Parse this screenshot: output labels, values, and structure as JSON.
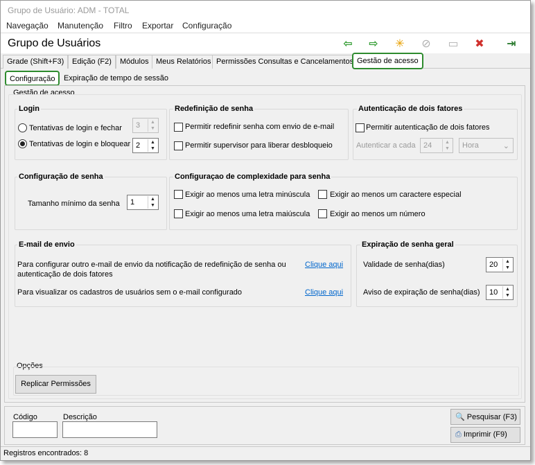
{
  "window": {
    "title": "Grupo de Usuário: ADM - TOTAL"
  },
  "menu": [
    "Navegação",
    "Manutenção",
    "Filtro",
    "Exportar",
    "Configuração"
  ],
  "header": {
    "title": "Grupo de Usuários"
  },
  "toolbar": {
    "back": "⇦",
    "forward": "⇨",
    "new": "✳",
    "cancel": "⊘",
    "save": "▭",
    "delete": "✖",
    "exit": "⇥"
  },
  "tabs": [
    "Grade (Shift+F3)",
    "Edição (F2)",
    "Módulos",
    "Meus Relatórios",
    "Permissões Consultas e Cancelamentos",
    "Gestão de acesso"
  ],
  "subtabs": [
    "Configuração",
    "Expiração de tempo de sessão"
  ],
  "gestao": {
    "title": "Gestão de acesso",
    "login": {
      "title": "Login",
      "opt1": "Tentativas de login e fechar",
      "opt1_value": "3",
      "opt2": "Tentativas de login e bloquear",
      "opt2_value": "2"
    },
    "redef": {
      "title": "Redefinição de senha",
      "opt1": "Permitir redefinir senha com envio de e-mail",
      "opt2": "Permitir supervisor para liberar desbloqueio"
    },
    "twofa": {
      "title": "Autenticação de dois fatores",
      "opt1": "Permitir autenticação de dois fatores",
      "cada_label": "Autenticar a cada",
      "cada_value": "24",
      "unit": "Hora"
    },
    "conf_senha": {
      "title": "Configuração de senha",
      "min_label": "Tamanho mínimo da senha",
      "min_value": "1"
    },
    "complex": {
      "title": "Configuraçao de complexidade para senha",
      "lower": "Exigir ao menos uma letra minúscula",
      "special": "Exigir ao menos um caractere especial",
      "upper": "Exigir ao menos uma letra maiúscula",
      "number": "Exigir ao menos um número"
    },
    "email": {
      "title": "E-mail de envio",
      "text1": "Para configurar outro e-mail de envio da notificação de redefinição de senha ou",
      "text1b": "autenticação de dois fatores",
      "link1": "Clique aqui",
      "text2": "Para visualizar os cadastros de usuários sem o e-mail configurado",
      "link2": "Clique aqui"
    },
    "expira": {
      "title": "Expiração de senha geral",
      "validade_label": "Validade de senha(dias)",
      "validade_value": "20",
      "aviso_label": "Aviso de expiração de senha(dias)",
      "aviso_value": "10"
    },
    "opcoes": {
      "title": "Opções",
      "replicar": "Replicar Permissões"
    }
  },
  "footer": {
    "codigo_label": "Código",
    "descricao_label": "Descrição",
    "codigo_value": "",
    "descricao_value": "",
    "pesquisar": "Pesquisar (F3)",
    "imprimir": "Imprimir (F9)"
  },
  "status": "Registros encontrados: 8",
  "colors": {
    "selected_outline": "#2e8b2e",
    "link": "#0066cc",
    "arrow_green": "#2e9b2e",
    "delete_red": "#d0312d"
  }
}
